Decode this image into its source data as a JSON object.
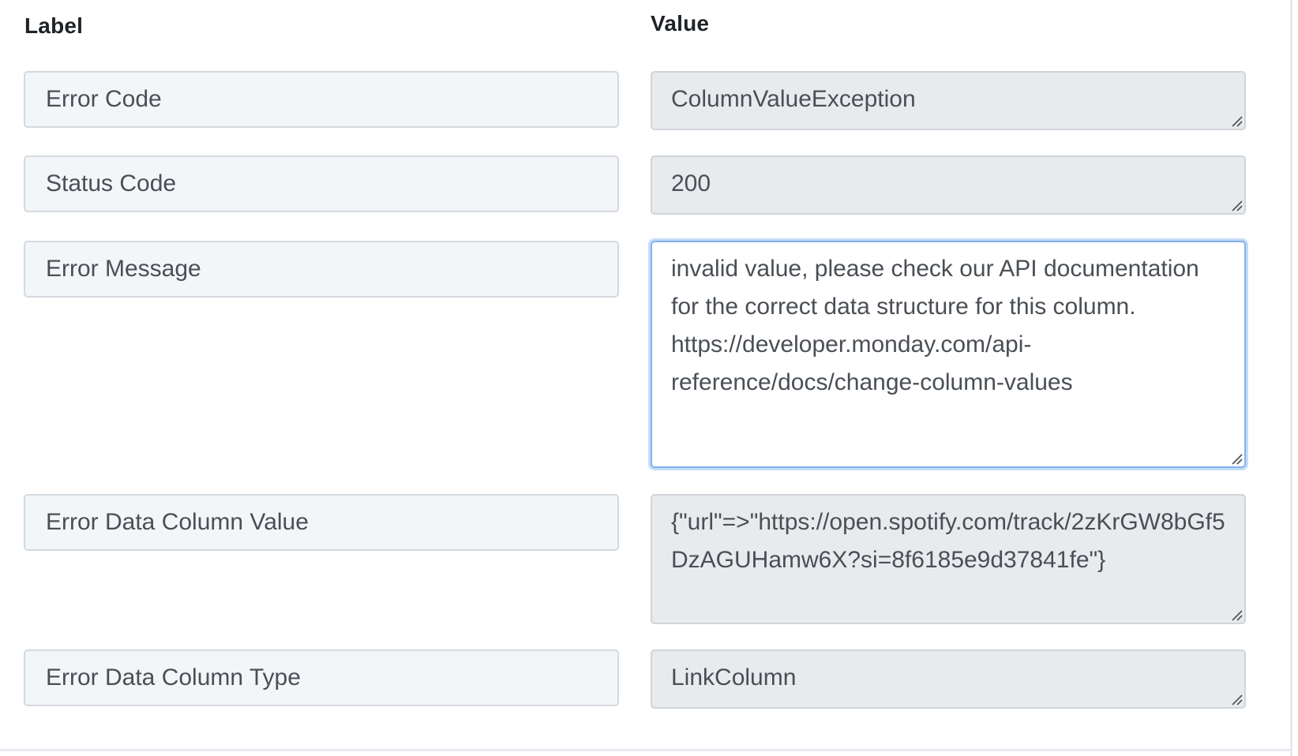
{
  "headers": {
    "label": "Label",
    "value": "Value"
  },
  "rows": [
    {
      "label": "Error Code",
      "value": "ColumnValueException"
    },
    {
      "label": "Status Code",
      "value": "200"
    },
    {
      "label": "Error Message",
      "value": "invalid value, please check our API documentation for the correct data structure for this column. https://developer.monday.com/api-reference/docs/change-column-values"
    },
    {
      "label": "Error Data Column Value",
      "value": "{\"url\"=>\"https://open.spotify.com/track/2zKrGW8bGf5DzAGUHamw6X?si=8f6185e9d37841fe\"}"
    },
    {
      "label": "Error Data Column Type",
      "value": "LinkColumn"
    }
  ],
  "focused_row": "Error Message",
  "icons": {
    "resize_handle": "resize-grip-icon"
  }
}
